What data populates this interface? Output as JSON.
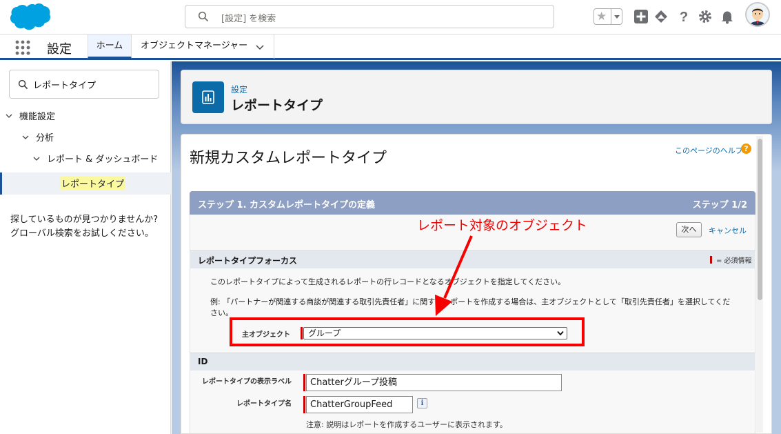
{
  "header": {
    "search_placeholder": "[設定] を検索",
    "icons": [
      "salesforce-logo",
      "search-icon",
      "star-icon",
      "add-icon",
      "trailhead-icon",
      "help-icon",
      "gear-icon",
      "bell-icon",
      "avatar"
    ]
  },
  "nav": {
    "app_name": "設定",
    "tabs": [
      {
        "label": "ホーム",
        "active": true
      },
      {
        "label": "オブジェクトマネージャー",
        "active": false
      }
    ]
  },
  "sidebar": {
    "search_value": "レポートタイプ",
    "tree": [
      {
        "label": "機能設定",
        "level": 0
      },
      {
        "label": "分析",
        "level": 1
      },
      {
        "label": "レポート & ダッシュボード",
        "level": 2
      },
      {
        "label": "レポートタイプ",
        "level": 3,
        "selected": true
      }
    ],
    "help_line1": "探しているものが見つかりませんか?",
    "help_line2": "グローバル検索をお試しください。"
  },
  "page_header": {
    "breadcrumb": "設定",
    "title": "レポートタイプ"
  },
  "content": {
    "title": "新規カスタムレポートタイプ",
    "help_link": "このページのヘルプ",
    "step": {
      "title": "ステップ 1. カスタムレポートタイプの定義",
      "counter": "ステップ 1/2",
      "next_button": "次へ",
      "cancel_link": "キャンセル"
    },
    "focus_section": {
      "title": "レポートタイプフォーカス",
      "required_legend": "= 必須情報",
      "desc1": "このレポートタイプによって生成されるレポートの行レコードとなるオブジェクトを指定してください。",
      "desc2_line1": "例: 「パートナーが関連する商談が関連する取引先責任者」に関するレポートを作成する場合は、主オブジェクトとして「取引先責任者」を選択してくだ",
      "desc2_line2": "さい。",
      "primary_object_label": "主オブジェクト",
      "primary_object_value": "グループ"
    },
    "id_section": {
      "title": "ID",
      "display_label_label": "レポートタイプの表示ラベル",
      "display_label_value": "Chatterグループ投稿",
      "name_label": "レポートタイプ名",
      "name_value": "ChatterGroupFeed",
      "info_icon": "i",
      "note": "注意: 説明はレポートを作成するユーザーに表示されます。"
    }
  },
  "annotation": {
    "text": "レポート対象のオブジェクト",
    "color": "#f60000"
  },
  "colors": {
    "brand": "#1b5297",
    "link": "#0b6aa8",
    "step_header": "#8e9fc4",
    "required": "#cc0000"
  }
}
